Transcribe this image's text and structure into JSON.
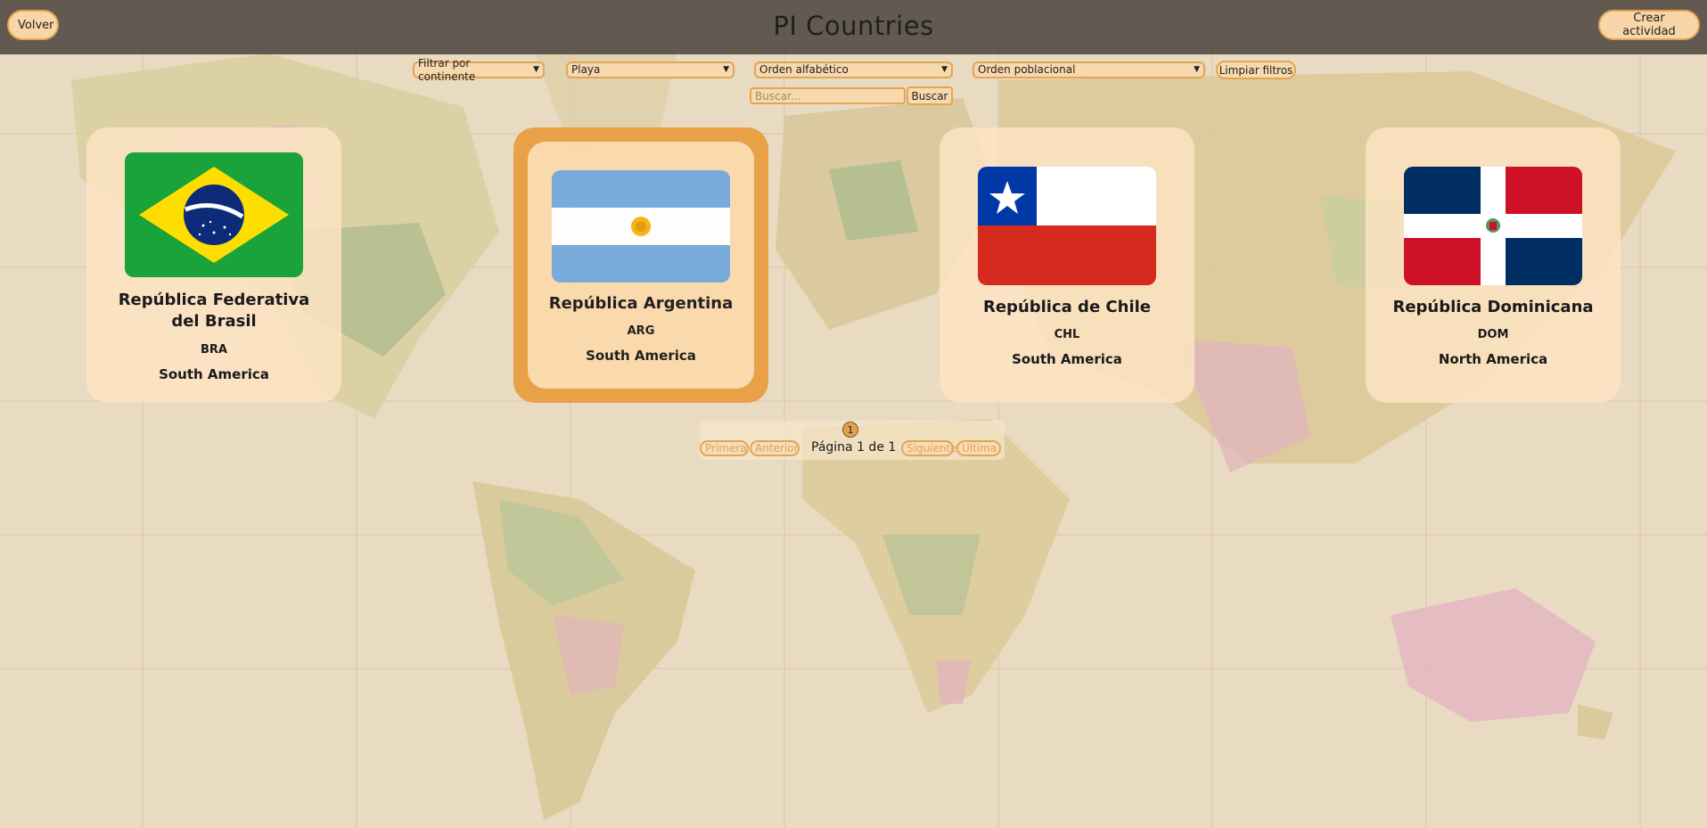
{
  "header": {
    "title": "PI Countries",
    "back_label": "Volver",
    "create_label": "Crear actividad"
  },
  "filters": {
    "continent": "Filtrar por continente",
    "activity": "Playa",
    "alphabetical": "Orden alfabético",
    "population": "Orden poblacional",
    "clear_label": "Limpiar filtros",
    "search_placeholder": "Buscar...",
    "search_label": "Buscar"
  },
  "countries": [
    {
      "name": "República Federativa del Brasil",
      "code": "BRA",
      "continent": "South America",
      "flag": "brazil-flag"
    },
    {
      "name": "República Argentina",
      "code": "ARG",
      "continent": "South America",
      "flag": "argentina-flag"
    },
    {
      "name": "República de Chile",
      "code": "CHL",
      "continent": "South America",
      "flag": "chile-flag"
    },
    {
      "name": "República Dominicana",
      "code": "DOM",
      "continent": "North America",
      "flag": "dominican-republic-flag"
    }
  ],
  "pagination": {
    "current_page": "1",
    "first_label": "Primera",
    "prev_label": "Anterior",
    "status": "Página 1 de 1",
    "next_label": "Siguiente",
    "last_label": "Ultima"
  },
  "colors": {
    "accent": "#e2a556",
    "card_bg": "#fde3c3",
    "active_card": "#ea9f44",
    "topbar": "#48423a"
  }
}
